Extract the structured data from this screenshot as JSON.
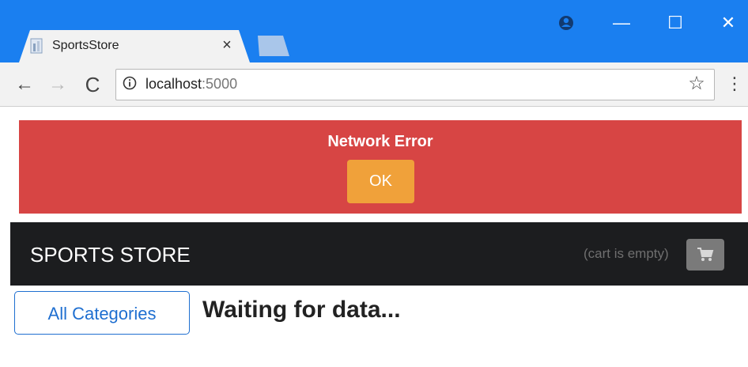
{
  "browser": {
    "tab_title": "SportsStore",
    "tab_close": "×",
    "url_host": "localhost",
    "url_port": ":5000",
    "controls": {
      "back": "←",
      "forward": "→",
      "reload": "C",
      "star": "☆",
      "menu": "⋮",
      "minimize": "—",
      "maximize": "☐",
      "close": "✕"
    }
  },
  "error": {
    "message": "Network Error",
    "ok_label": "OK"
  },
  "navbar": {
    "brand": "SPORTS STORE",
    "cart_status": "(cart is empty)"
  },
  "main": {
    "categories_button": "All Categories",
    "status": "Waiting for data..."
  },
  "colors": {
    "chrome_blue": "#1a7ff0",
    "error_red": "#d74544",
    "ok_orange": "#f0a13a",
    "navbar_dark": "#1c1d1f",
    "link_blue": "#1f6fd0"
  },
  "icons": [
    "favicon-icon",
    "account-icon",
    "info-icon",
    "star-icon",
    "menu-icon",
    "cart-icon"
  ]
}
